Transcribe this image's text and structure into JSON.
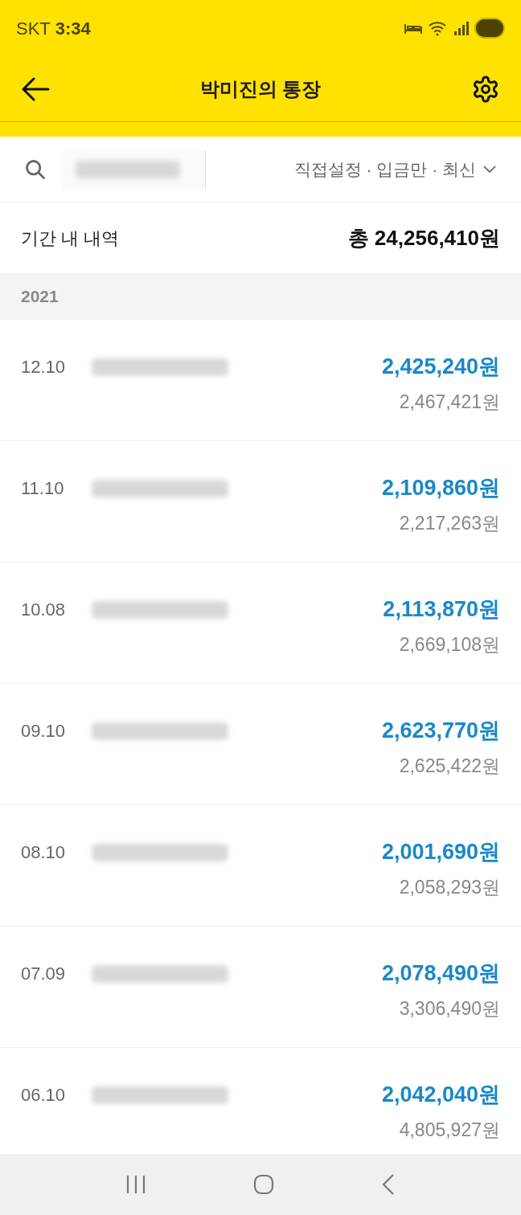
{
  "status_bar": {
    "carrier": "SKT",
    "time": "3:34"
  },
  "app_bar": {
    "title": "박미진의 통장"
  },
  "filter": {
    "summary": "직접설정 · 입금만 · 최신"
  },
  "period": {
    "label": "기간 내 내역",
    "total": "총 24,256,410원"
  },
  "year": "2021",
  "transactions": [
    {
      "date": "12.10",
      "amount": "2,425,240원",
      "balance": "2,467,421원"
    },
    {
      "date": "11.10",
      "amount": "2,109,860원",
      "balance": "2,217,263원"
    },
    {
      "date": "10.08",
      "amount": "2,113,870원",
      "balance": "2,669,108원"
    },
    {
      "date": "09.10",
      "amount": "2,623,770원",
      "balance": "2,625,422원"
    },
    {
      "date": "08.10",
      "amount": "2,001,690원",
      "balance": "2,058,293원"
    },
    {
      "date": "07.09",
      "amount": "2,078,490원",
      "balance": "3,306,490원"
    },
    {
      "date": "06.10",
      "amount": "2,042,040원",
      "balance": "4,805,927원"
    }
  ]
}
